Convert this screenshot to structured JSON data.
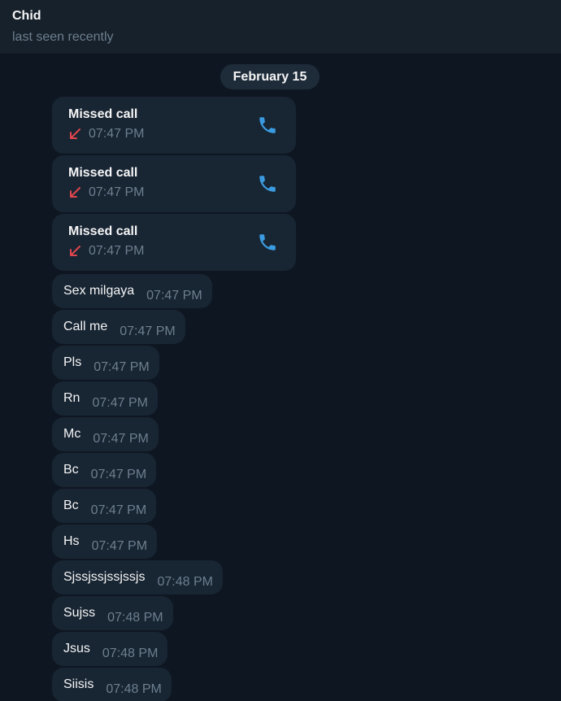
{
  "header": {
    "name": "Chid",
    "status": "last seen recently"
  },
  "date_separator": "February 15",
  "colors": {
    "background": "#0e1621",
    "bubble": "#182533",
    "accent_blue": "#3a9be0",
    "missed_red": "#e0464e",
    "muted_text": "#6d7f8f"
  },
  "calls": [
    {
      "title": "Missed call",
      "time": "07:47 PM",
      "direction_icon": "missed-call-arrow-icon",
      "action_icon": "phone-icon"
    },
    {
      "title": "Missed call",
      "time": "07:47 PM",
      "direction_icon": "missed-call-arrow-icon",
      "action_icon": "phone-icon"
    },
    {
      "title": "Missed call",
      "time": "07:47 PM",
      "direction_icon": "missed-call-arrow-icon",
      "action_icon": "phone-icon"
    }
  ],
  "messages": [
    {
      "text": "Sex milgaya",
      "time": "07:47 PM"
    },
    {
      "text": "Call me",
      "time": "07:47 PM"
    },
    {
      "text": "Pls",
      "time": "07:47 PM"
    },
    {
      "text": "Rn",
      "time": "07:47 PM"
    },
    {
      "text": "Mc",
      "time": "07:47 PM"
    },
    {
      "text": "Bc",
      "time": "07:47 PM"
    },
    {
      "text": "Bc",
      "time": "07:47 PM"
    },
    {
      "text": "Hs",
      "time": "07:47 PM"
    },
    {
      "text": "Sjssjssjssjssjs",
      "time": "07:48 PM"
    },
    {
      "text": "Sujss",
      "time": "07:48 PM"
    },
    {
      "text": "Jsus",
      "time": "07:48 PM"
    },
    {
      "text": "Siisis",
      "time": "07:48 PM"
    }
  ]
}
